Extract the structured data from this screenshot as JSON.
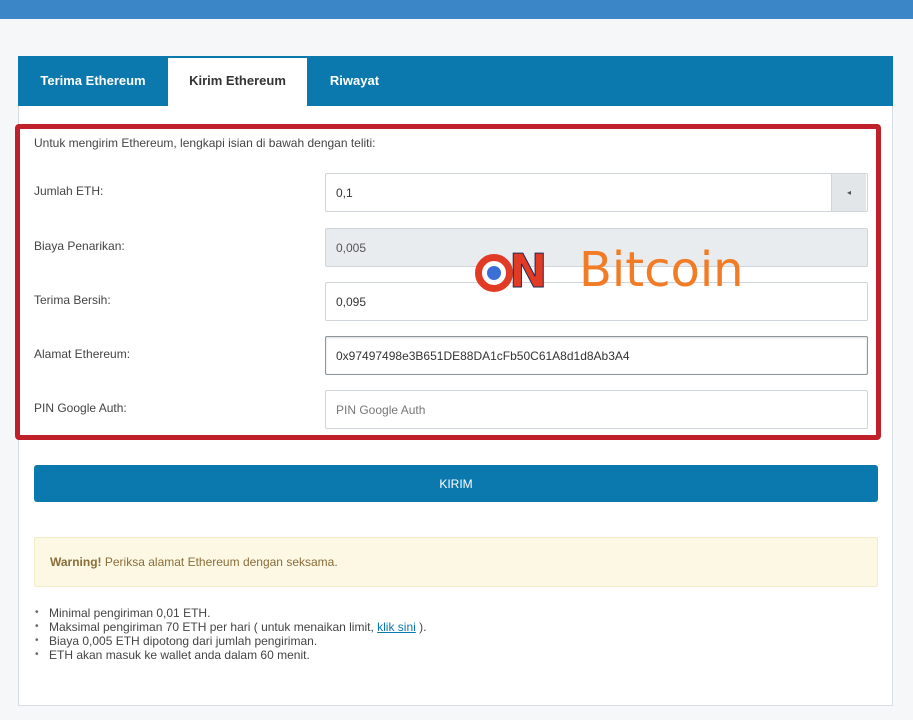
{
  "tabs": [
    "Terima Ethereum",
    "Kirim Ethereum",
    "Riwayat"
  ],
  "intro": "Untuk mengirim Ethereum, lengkapi isian di bawah dengan teliti:",
  "fields": {
    "amount": {
      "label": "Jumlah ETH:",
      "value": "0,1"
    },
    "fee": {
      "label": "Biaya Penarikan:",
      "value": "0,005"
    },
    "net": {
      "label": "Terima Bersih:",
      "value": "0,095"
    },
    "address": {
      "label": "Alamat Ethereum:",
      "value": "0x97497498e3B651DE88DA1cFb50C61A8d1d8Ab3A4"
    },
    "pin": {
      "label": "PIN Google Auth:",
      "placeholder": "PIN Google Auth"
    }
  },
  "spin_glyph": "◂",
  "submit_label": "KIRIM",
  "warning": {
    "strong": "Warning!",
    "text": " Periksa alamat Ethereum dengan seksama."
  },
  "notes": {
    "n1": "Minimal pengiriman 0,01 ETH.",
    "n2_pre": "Maksimal pengiriman 70 ETH per hari ( untuk menaikan limit, ",
    "n2_link": "klik sini",
    "n2_post": " ).",
    "n3": "Biaya 0,005 ETH dipotong dari jumlah pengiriman.",
    "n4": "ETH akan masuk ke wallet anda dalam 60 menit."
  },
  "watermark": {
    "n": "N",
    "bitcoin": "Bitcoin"
  },
  "colors": {
    "accent": "#0b79ad",
    "highlight_border": "#c0202a",
    "warning_bg": "#fcf8e3"
  }
}
